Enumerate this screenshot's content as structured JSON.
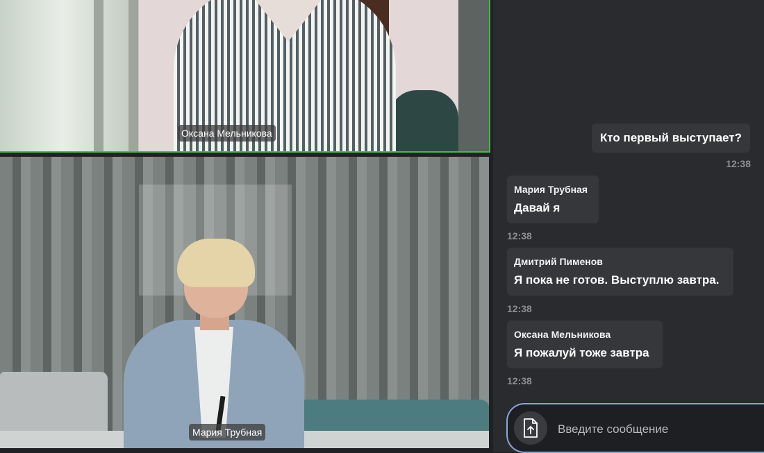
{
  "video": {
    "participants": [
      {
        "name": "Оксана Мельникова",
        "speaking": true,
        "border_color": "#3cc13a"
      },
      {
        "name": "Мария Трубная",
        "speaking": false
      }
    ]
  },
  "chat": {
    "messages": [
      {
        "direction": "outgoing",
        "text": "Кто первый выступает?",
        "time": "12:38"
      },
      {
        "direction": "incoming",
        "sender": "Мария Трубная",
        "text": "Давай я",
        "time": "12:38"
      },
      {
        "direction": "incoming",
        "sender": "Дмитрий Пименов",
        "text": "Я пока не готов. Выступлю завтра.",
        "time": "12:38"
      },
      {
        "direction": "incoming",
        "sender": "Оксана Мельникова",
        "text": "Я пожалуй тоже завтра",
        "time": "12:38"
      }
    ],
    "composer": {
      "placeholder": "Введите сообщение",
      "value": "",
      "attach_icon": "file-upload-icon"
    }
  }
}
